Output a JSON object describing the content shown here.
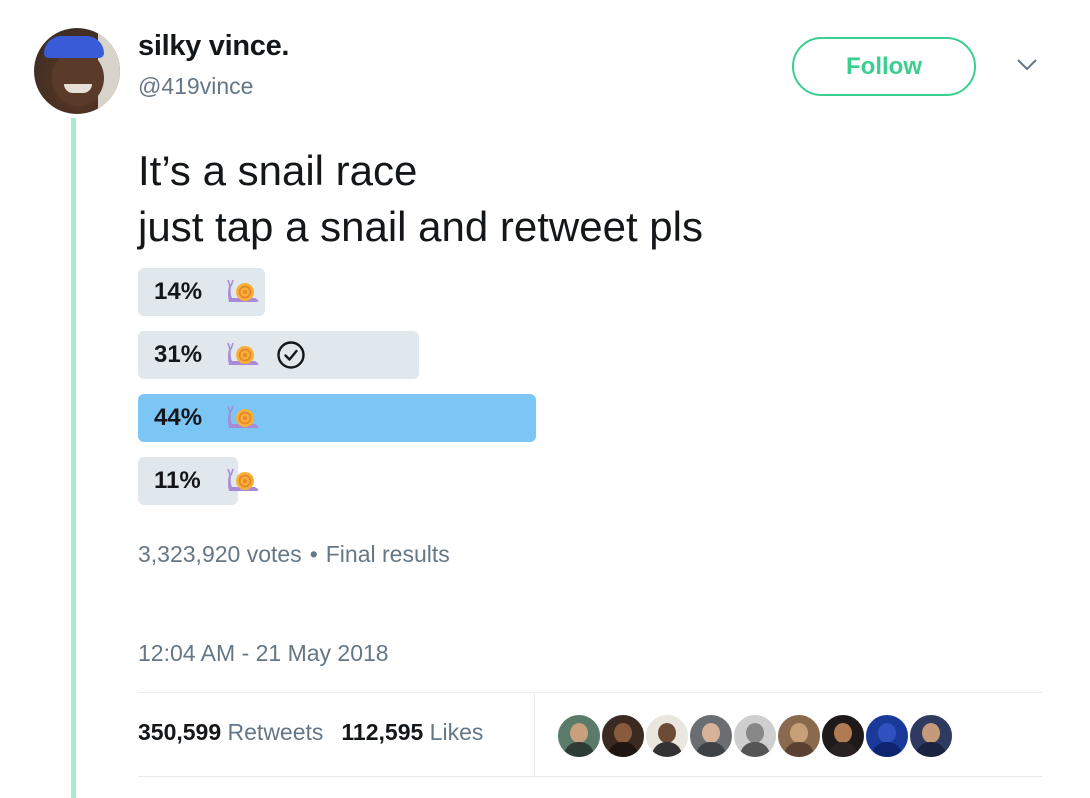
{
  "user": {
    "name": "silky vince.",
    "handle": "@419vince"
  },
  "follow_button": {
    "label": "Follow"
  },
  "tweet": {
    "lines": [
      "It’s a snail race",
      "just tap a snail and retweet pls"
    ]
  },
  "poll": {
    "options": [
      {
        "percent_label": "14%",
        "percent": 14,
        "icon": "snail-icon",
        "selected": false,
        "winner": false
      },
      {
        "percent_label": "31%",
        "percent": 31,
        "icon": "snail-icon",
        "selected": true,
        "winner": false
      },
      {
        "percent_label": "44%",
        "percent": 44,
        "icon": "snail-icon",
        "selected": false,
        "winner": true
      },
      {
        "percent_label": "11%",
        "percent": 11,
        "icon": "snail-icon",
        "selected": false,
        "winner": false
      }
    ],
    "votes": "3,323,920 votes",
    "separator": "•",
    "status": "Final results"
  },
  "timestamp": "12:04 AM - 21 May 2018",
  "stats": {
    "retweets_count": "350,599",
    "retweets_label": "Retweets",
    "likes_count": "112,595",
    "likes_label": "Likes"
  },
  "colors": {
    "accent_green": "#3bcf8f",
    "thread_line": "#a8ecd0",
    "poll_bar": "#e1e8ed",
    "poll_winner_bar": "#7cc6f6",
    "muted_text": "#657786"
  }
}
